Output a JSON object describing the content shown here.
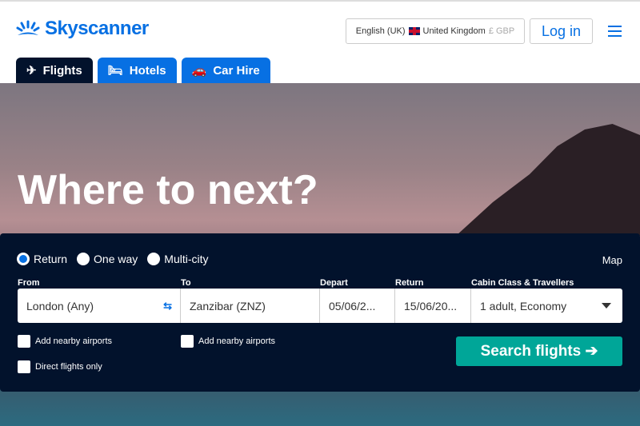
{
  "header": {
    "logo_text": "Skyscanner",
    "locale": {
      "language": "English (UK)",
      "country": "United Kingdom",
      "currency": "£ GBP"
    },
    "login_label": "Log in"
  },
  "tabs": [
    {
      "label": "Flights",
      "icon": "plane-icon",
      "active": true
    },
    {
      "label": "Hotels",
      "icon": "bed-icon"
    },
    {
      "label": "Car Hire",
      "icon": "car-icon"
    }
  ],
  "hero": {
    "headline": "Where to next?"
  },
  "search": {
    "trip_types": [
      {
        "label": "Return",
        "selected": true
      },
      {
        "label": "One way"
      },
      {
        "label": "Multi-city"
      }
    ],
    "map_label": "Map",
    "from": {
      "label": "From",
      "value": "London (Any)"
    },
    "to": {
      "label": "To",
      "value": "Zanzibar (ZNZ)"
    },
    "depart": {
      "label": "Depart",
      "value": "05/06/2..."
    },
    "return": {
      "label": "Return",
      "value": "15/06/20..."
    },
    "cabin": {
      "label": "Cabin Class & Travellers",
      "value": "1 adult, Economy"
    },
    "nearby_from": "Add nearby airports",
    "nearby_to": "Add nearby airports",
    "direct": "Direct flights only",
    "button": "Search flights ➔"
  },
  "colors": {
    "brand": "#0770e3",
    "panel": "#02122c",
    "search": "#00a698"
  }
}
